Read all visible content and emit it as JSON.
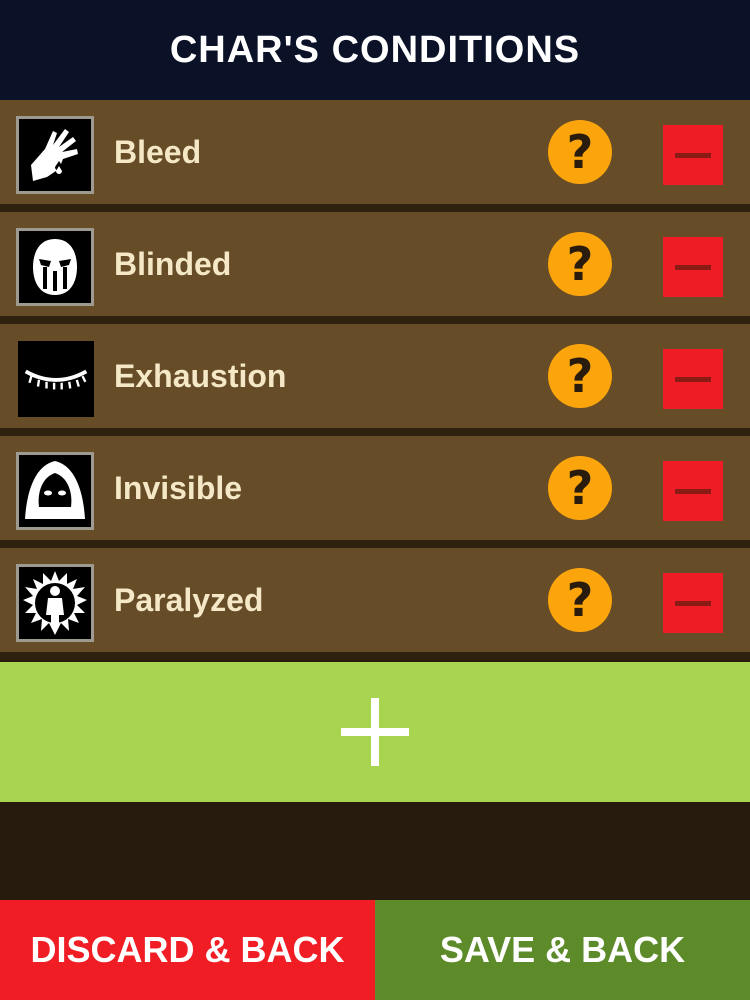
{
  "header": {
    "title": "CHAR'S CONDITIONS"
  },
  "conditions": [
    {
      "label": "Bleed",
      "icon": "bleed-hand-icon"
    },
    {
      "label": "Blinded",
      "icon": "blinded-mask-icon"
    },
    {
      "label": "Exhaustion",
      "icon": "closed-eye-icon"
    },
    {
      "label": "Invisible",
      "icon": "hooded-figure-icon"
    },
    {
      "label": "Paralyzed",
      "icon": "burst-figure-icon"
    }
  ],
  "help_glyph": "?",
  "footer": {
    "discard_label": "DISCARD & BACK",
    "save_label": "SAVE & BACK"
  },
  "colors": {
    "header_bg": "#0b1228",
    "row_bg": "#674c28",
    "help": "#fca40b",
    "remove": "#ee1d25",
    "add": "#a9d44f",
    "discard": "#f11d25",
    "save": "#5d8b2a"
  }
}
